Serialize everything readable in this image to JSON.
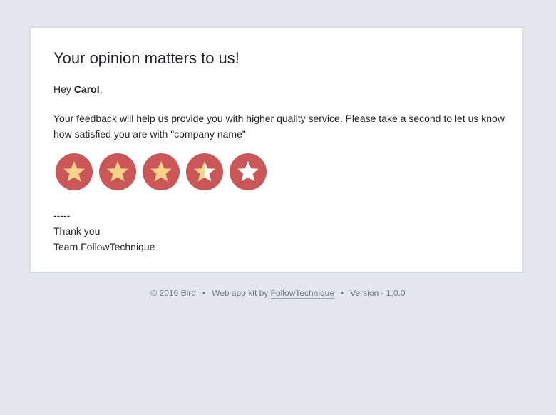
{
  "email": {
    "title": "Your opinion matters to us!",
    "greeting_prefix": "Hey ",
    "name": "Carol",
    "greeting_suffix": ",",
    "body": "Your feedback will help us provide you with higher quality service. Please take a second to let us know how satisfied you are with \"company name\"",
    "rating": {
      "value": 3.5,
      "max": 5,
      "icons": [
        "star-icon",
        "star-icon",
        "star-icon",
        "half-star-icon",
        "empty-star-icon"
      ]
    },
    "signoff": {
      "separator": "-----",
      "line1": "Thank you",
      "line2": "Team FollowTechnique"
    }
  },
  "footer": {
    "copyright": "© 2016 Bird",
    "bullet": "•",
    "kit_prefix": "Web app kit by ",
    "kit_link": "FollowTechnique",
    "version": "Version - 1.0.0"
  },
  "colors": {
    "background": "#e3e8ef",
    "card": "#ffffff",
    "star_circle": "#c95757",
    "star_fill": "#f9d38a",
    "star_empty": "#ffffff"
  }
}
